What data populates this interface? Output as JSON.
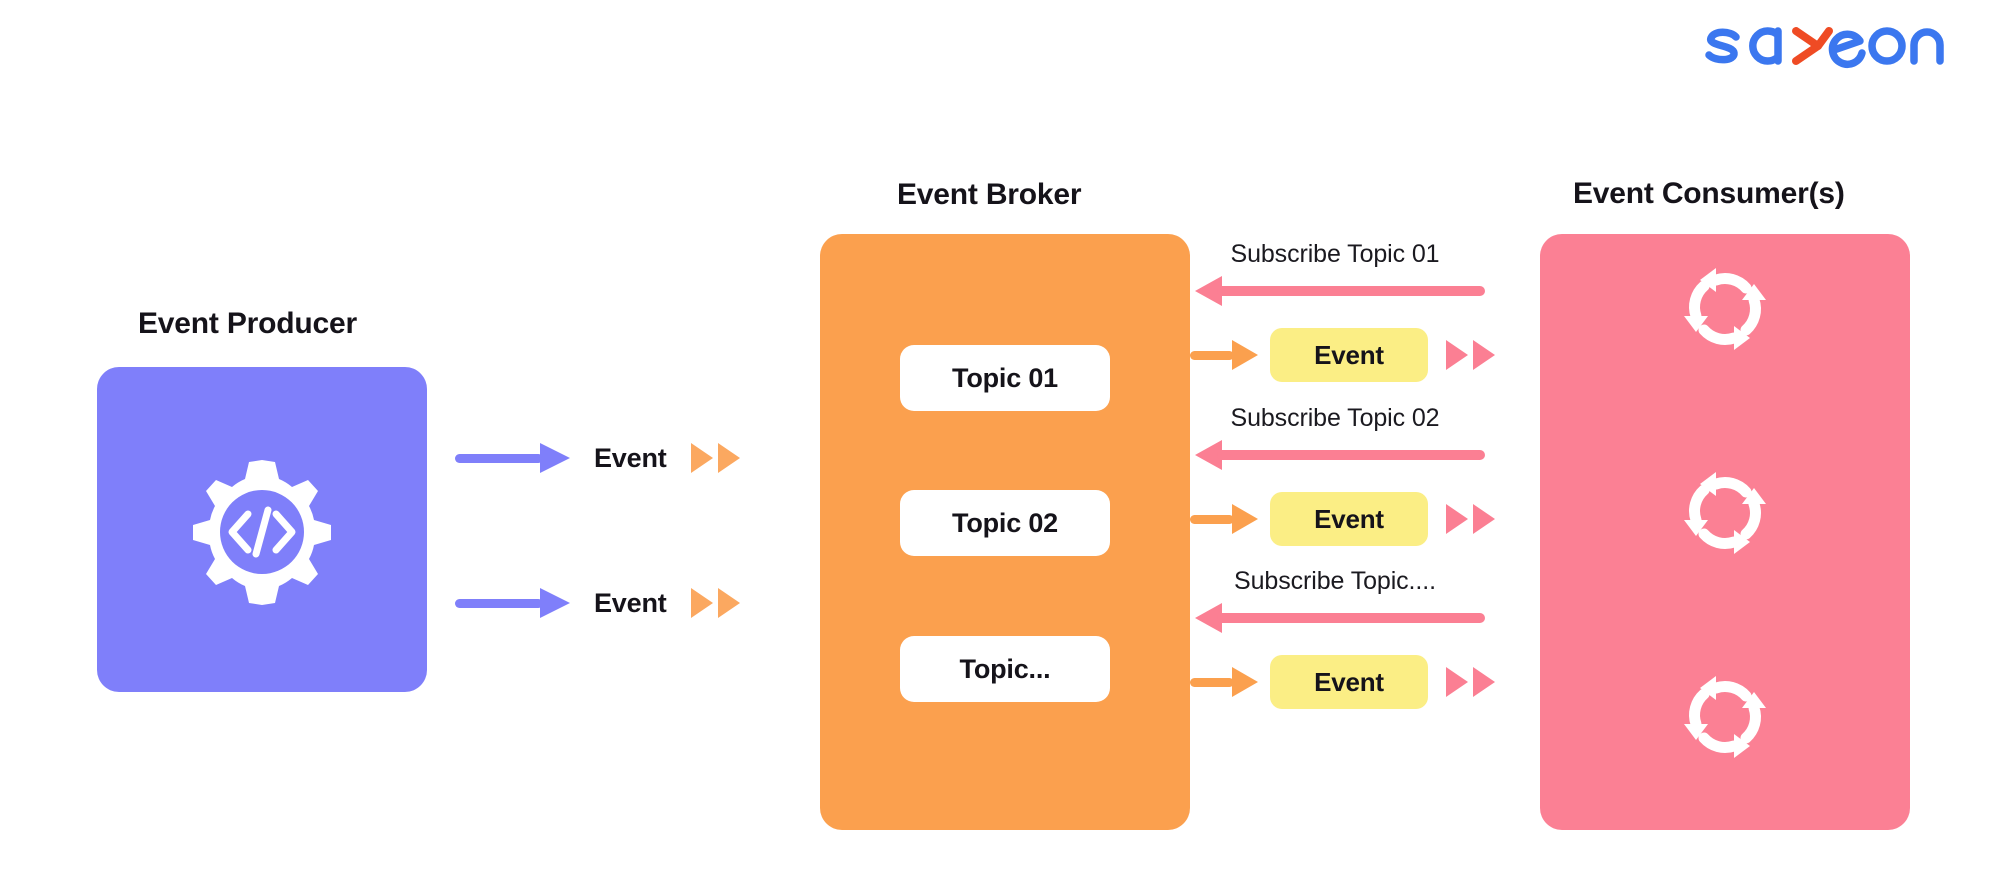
{
  "brand": {
    "logo_text": "sayone",
    "logo_primary_color": "#3b77ef",
    "logo_accent_color": "#ef4b24"
  },
  "colors": {
    "producer_panel": "#7f7ffa",
    "broker_panel": "#fba04e",
    "consumer_panel": "#fb8094",
    "event_pill": "#fbee85",
    "topic_card": "#ffffff",
    "publish_arrow": "#7f7ffa",
    "subscribe_arrow": "#fb7f93",
    "deliver_arrow": "#fba04e",
    "text": "#15131a",
    "background": "#ffffff"
  },
  "producer": {
    "title": "Event Producer",
    "icon": "gear-code-icon",
    "publish_rows": [
      {
        "label": "Event",
        "arrow_icon": "arrow-right-icon",
        "chevrons_icon": "double-triangle-right-icon"
      },
      {
        "label": "Event",
        "arrow_icon": "arrow-right-icon",
        "chevrons_icon": "double-triangle-right-icon"
      }
    ]
  },
  "broker": {
    "title": "Event Broker",
    "topics": [
      {
        "label": "Topic 01"
      },
      {
        "label": "Topic 02"
      },
      {
        "label": "Topic..."
      }
    ]
  },
  "subscriptions": [
    {
      "subscribe_label": "Subscribe Topic 01",
      "subscribe_arrow_icon": "arrow-left-icon",
      "deliver_arrow_icon": "arrow-right-icon",
      "event_label": "Event",
      "chevrons_icon": "double-triangle-right-icon"
    },
    {
      "subscribe_label": "Subscribe Topic 02",
      "subscribe_arrow_icon": "arrow-left-icon",
      "deliver_arrow_icon": "arrow-right-icon",
      "event_label": "Event",
      "chevrons_icon": "double-triangle-right-icon"
    },
    {
      "subscribe_label": "Subscribe Topic....",
      "subscribe_arrow_icon": "arrow-left-icon",
      "deliver_arrow_icon": "arrow-right-icon",
      "event_label": "Event",
      "chevrons_icon": "double-triangle-right-icon"
    }
  ],
  "consumer": {
    "title": "Event Consumer(s)",
    "instances": [
      {
        "icon": "cyclic-arrows-icon"
      },
      {
        "icon": "cyclic-arrows-icon"
      },
      {
        "icon": "cyclic-arrows-icon"
      }
    ]
  }
}
